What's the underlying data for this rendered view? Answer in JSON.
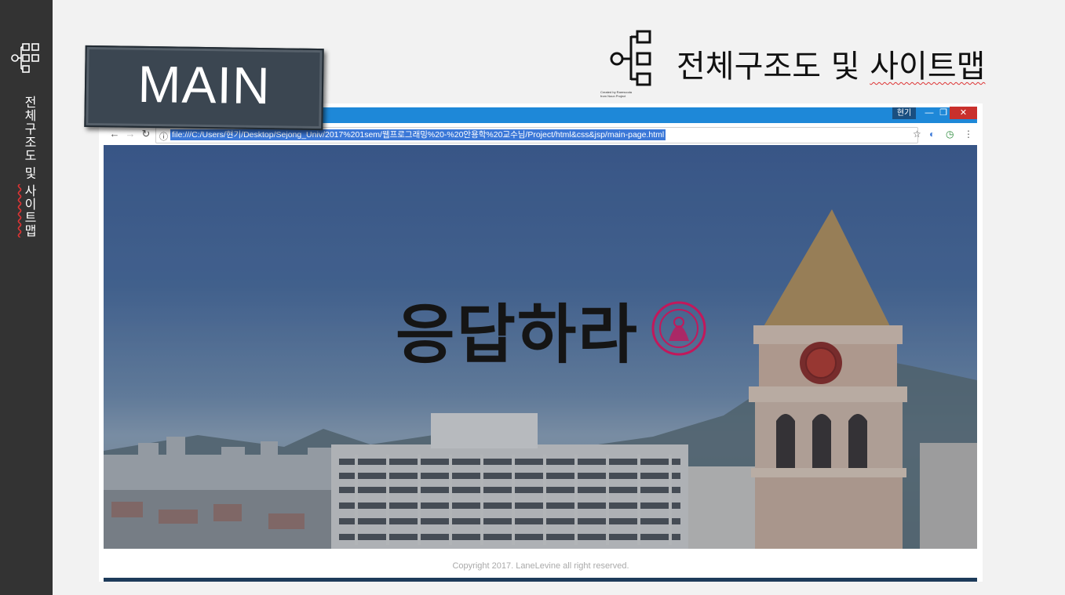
{
  "sidebar": {
    "title_prefix": "전체구조도 및 ",
    "title_marked": "사이트맵"
  },
  "header": {
    "title_prefix": "전체구조도 및 ",
    "title_marked": "사이트맵",
    "icon": "sitemap-icon",
    "icon_credit_line1": "Created by Raresvoda",
    "icon_credit_line2": "from Noun Project"
  },
  "section_label": "MAIN",
  "browser": {
    "user_chip": "현기",
    "url": "file:///C:/Users/현기/Desktop/Sejong_Univ/2017%201sem/웹프로그래밍%20-%20안용학%20교수님/Project/html&css&jsp/main-page.html",
    "nav_icons": [
      "arrow-left-icon",
      "arrow-right-icon",
      "reload-icon"
    ],
    "toolbar_icons": [
      "star-icon",
      "extension-icon",
      "extension-icon",
      "menu-icon"
    ],
    "win_buttons": [
      "minimize-icon",
      "maximize-icon",
      "close-icon"
    ]
  },
  "hero": {
    "logo_text": "응답하라",
    "seal": "university-seal-icon"
  },
  "footer": {
    "copyright": "Copyright 2017. LaneLevine all right reserved."
  },
  "colors": {
    "rail": "#333333",
    "titlebar": "#1e88d8",
    "url_highlight": "#3b78d8",
    "seal": "#c2185b"
  }
}
